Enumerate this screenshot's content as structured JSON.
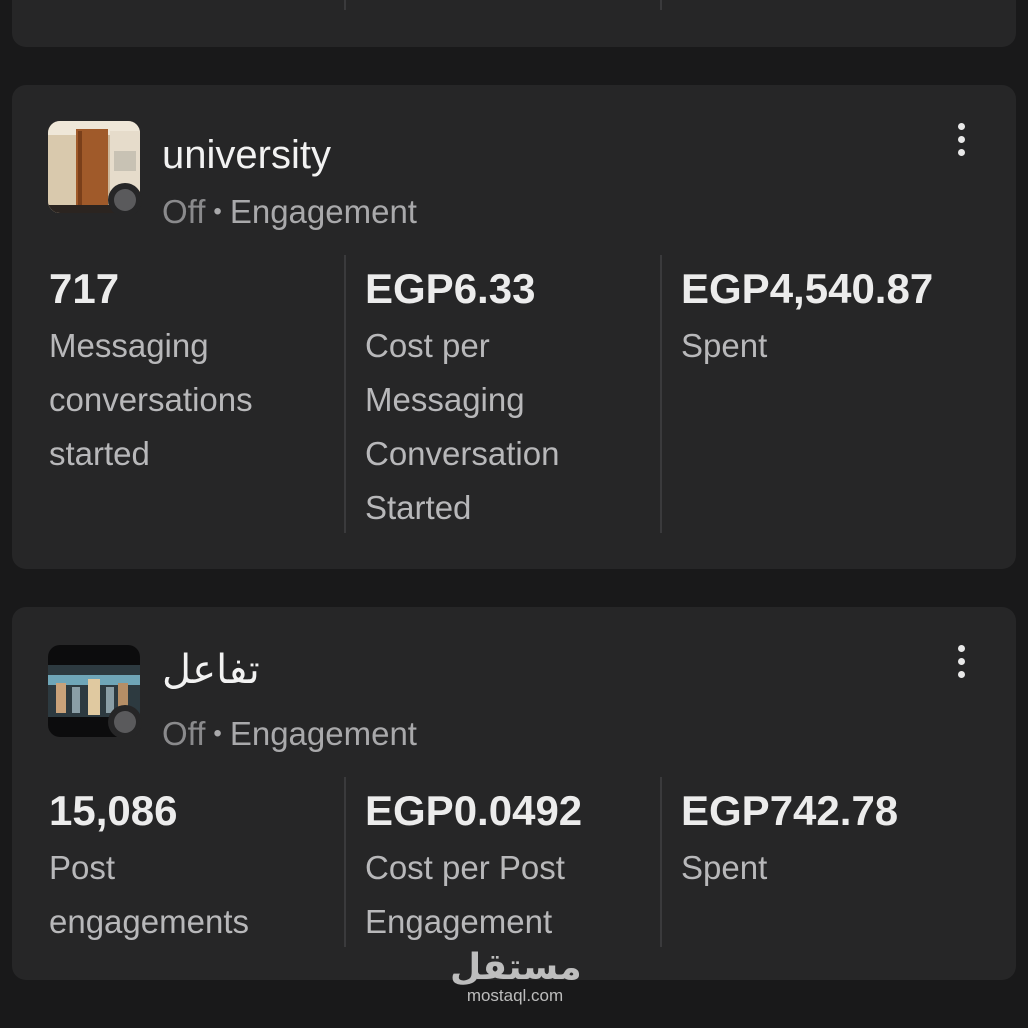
{
  "cards": [
    {
      "name": "university",
      "status": "Off",
      "separator": "•",
      "objective": "Engagement",
      "metrics": [
        {
          "value": "717",
          "label": "Messaging conversations started"
        },
        {
          "value": "EGP6.33",
          "label": "Cost per Messaging Conversation Started"
        },
        {
          "value": "EGP4,540.87",
          "label": "Spent"
        }
      ]
    },
    {
      "name": "تفاعل",
      "status": "Off",
      "separator": "•",
      "objective": "Engagement",
      "metrics": [
        {
          "value": "15,086",
          "label": "Post engagements"
        },
        {
          "value": "EGP0.0492",
          "label": "Cost per Post Engagement"
        },
        {
          "value": "EGP742.78",
          "label": "Spent"
        }
      ]
    }
  ],
  "watermark": {
    "arabic": "مستقل",
    "latin": "mostaql.com"
  },
  "colors": {
    "background": "#19191a",
    "card": "#262627",
    "status_off": "#5a5a5c"
  }
}
